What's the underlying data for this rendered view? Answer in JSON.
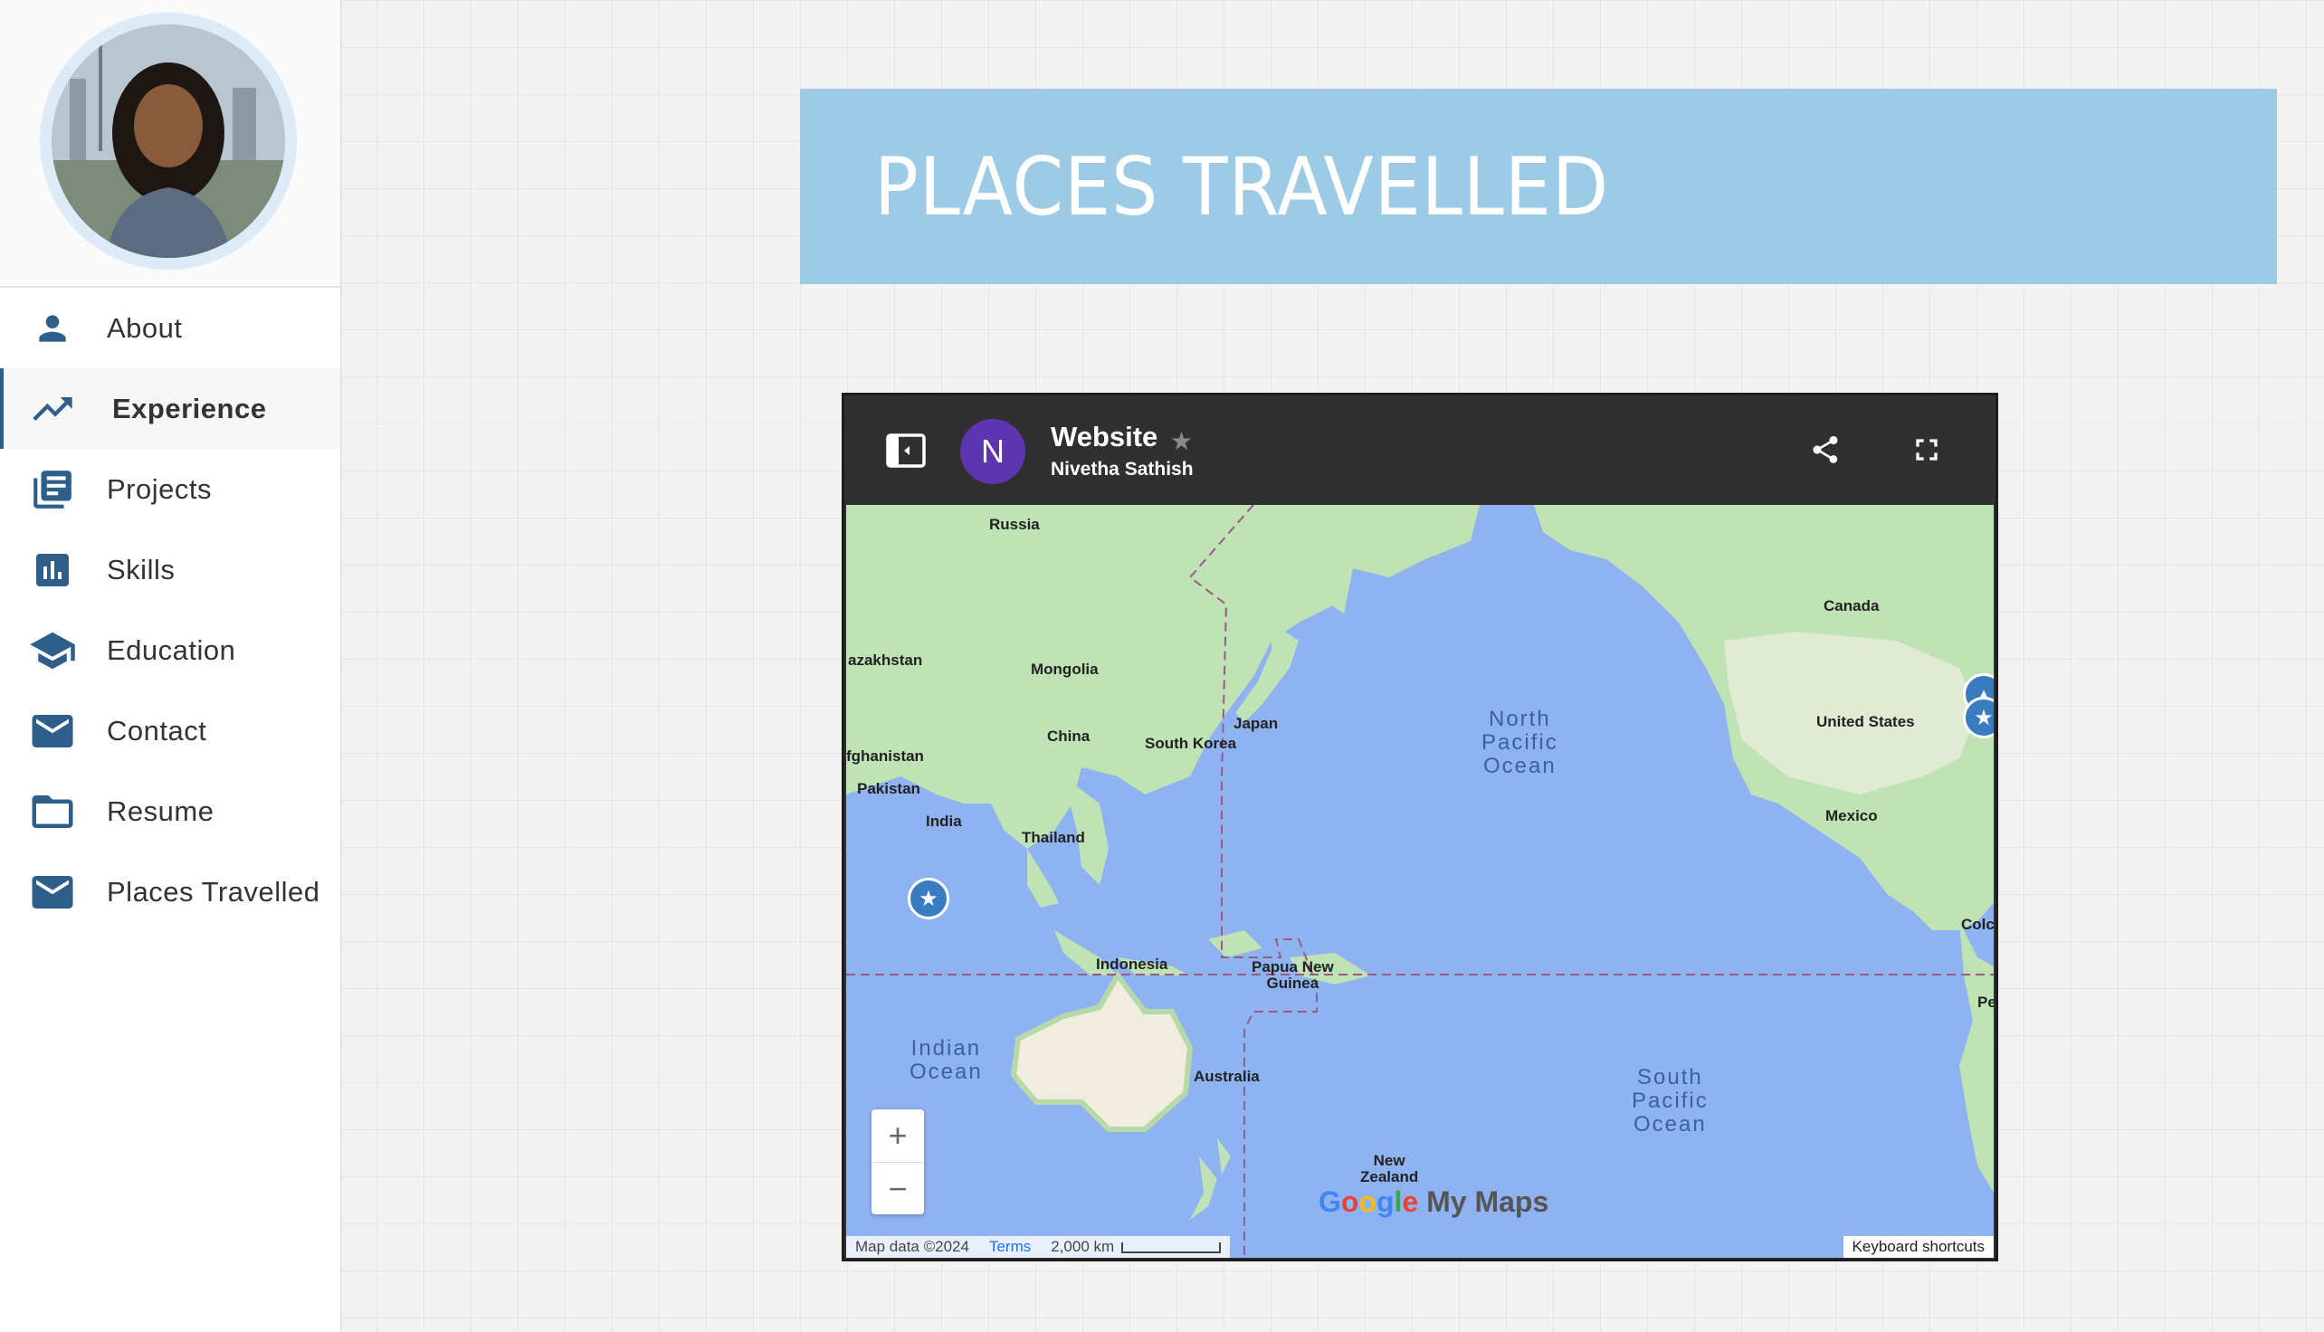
{
  "sidebar": {
    "items": [
      {
        "label": "About",
        "icon": "person-icon"
      },
      {
        "label": "Experience",
        "icon": "trending-up-icon"
      },
      {
        "label": "Projects",
        "icon": "article-icon"
      },
      {
        "label": "Skills",
        "icon": "bar-chart-icon"
      },
      {
        "label": "Education",
        "icon": "school-icon"
      },
      {
        "label": "Contact",
        "icon": "mail-icon"
      },
      {
        "label": "Resume",
        "icon": "folder-icon"
      },
      {
        "label": "Places Travelled",
        "icon": "mail-icon"
      }
    ],
    "active_item": "Experience"
  },
  "banner": {
    "title": "PLACES TRAVELLED"
  },
  "map": {
    "owner_initial": "N",
    "title": "Website",
    "owner_name": "Nivetha Sathish",
    "labels": {
      "russia": "Russia",
      "kazakhstan": "azakhstan",
      "mongolia": "Mongolia",
      "china": "China",
      "afghanistan": "fghanistan",
      "pakistan": "Pakistan",
      "india": "India",
      "thailand": "Thailand",
      "south_korea": "South Korea",
      "japan": "Japan",
      "indonesia": "Indonesia",
      "png": "Papua New\nGuinea",
      "australia": "Australia",
      "nz": "New\nZealand",
      "canada": "Canada",
      "usa": "United States",
      "mexico": "Mexico",
      "colombia": "Colc",
      "peru": "Pe"
    },
    "oceans": {
      "north_pacific": "North\nPacific\nOcean",
      "indian": "Indian\nOcean",
      "south_pacific": "South\nPacific\nOcean"
    },
    "zoom_in": "+",
    "zoom_out": "−",
    "attribution": "Map data ©2024",
    "terms": "Terms",
    "scale": "2,000 km",
    "keyboard_shortcuts": "Keyboard shortcuts",
    "logo_text": "My Maps",
    "colors": {
      "water": "#8fb2f0",
      "land": "#bfe3b4",
      "marker": "#3a7cc2"
    }
  }
}
